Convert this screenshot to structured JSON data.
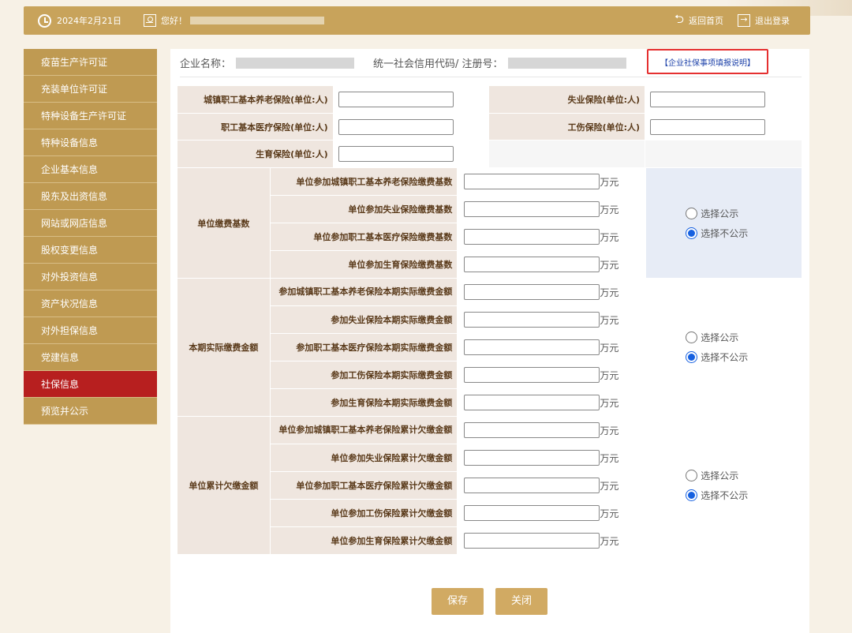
{
  "topbar": {
    "date": "2024年2月21日",
    "greeting": "您好！",
    "back_home": "返回首页",
    "logout": "退出登录"
  },
  "sidebar": {
    "items": [
      {
        "label": "疫苗生产许可证"
      },
      {
        "label": "充装单位许可证"
      },
      {
        "label": "特种设备生产许可证"
      },
      {
        "label": "特种设备信息"
      },
      {
        "label": "企业基本信息"
      },
      {
        "label": "股东及出资信息"
      },
      {
        "label": "网站或网店信息"
      },
      {
        "label": "股权变更信息"
      },
      {
        "label": "对外投资信息"
      },
      {
        "label": "资产状况信息"
      },
      {
        "label": "对外担保信息"
      },
      {
        "label": "党建信息"
      },
      {
        "label": "社保信息"
      },
      {
        "label": "预览并公示"
      }
    ],
    "active_index": 12
  },
  "company": {
    "name_label": "企业名称：",
    "code_label": "统一社会信用代码/ 注册号：",
    "note_link": "【企业社保事项填报说明】"
  },
  "insured": {
    "pension_label": "城镇职工基本养老保险(单位:人)",
    "unemployment_label": "失业保险(单位:人)",
    "medical_label": "职工基本医疗保险(单位:人)",
    "injury_label": "工伤保险(单位:人)",
    "maternity_label": "生育保险(单位:人)"
  },
  "unit": "万元",
  "radio": {
    "public": "选择公示",
    "not_public": "选择不公示"
  },
  "groups": [
    {
      "title": "单位缴费基数",
      "rows": [
        "单位参加城镇职工基本养老保险缴费基数",
        "单位参加失业保险缴费基数",
        "单位参加职工基本医疗保险缴费基数",
        "单位参加生育保险缴费基数"
      ]
    },
    {
      "title": "本期实际缴费金额",
      "rows": [
        "参加城镇职工基本养老保险本期实际缴费金额",
        "参加失业保险本期实际缴费金额",
        "参加职工基本医疗保险本期实际缴费金额",
        "参加工伤保险本期实际缴费金额",
        "参加生育保险本期实际缴费金额"
      ]
    },
    {
      "title": "单位累计欠缴金额",
      "rows": [
        "单位参加城镇职工基本养老保险累计欠缴金额",
        "单位参加失业保险累计欠缴金额",
        "单位参加职工基本医疗保险累计欠缴金额",
        "单位参加工伤保险累计欠缴金额",
        "单位参加生育保险累计欠缴金额"
      ]
    }
  ],
  "buttons": {
    "save": "保存",
    "close": "关闭"
  }
}
